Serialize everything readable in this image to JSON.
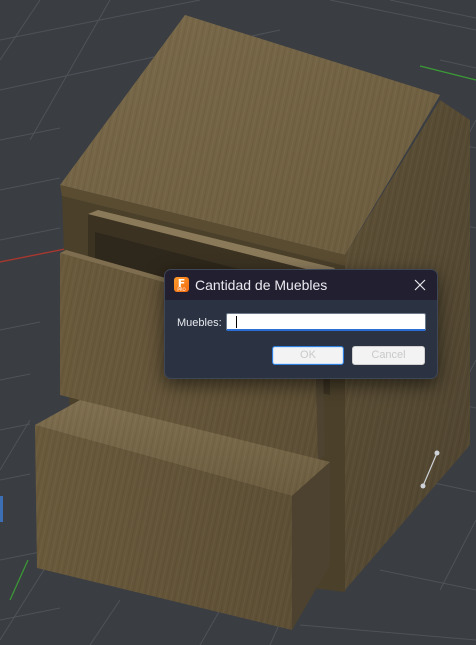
{
  "viewport": {
    "background": "#3a3d42",
    "grid_color": "#55585e",
    "axis_red": "#b8392f",
    "axis_green": "#3fae3a",
    "wood_light": "#756546",
    "wood_mid": "#5f5236",
    "wood_dark": "#4a3f28"
  },
  "dialog": {
    "title": "Cantidad de Muebles",
    "app_icon": {
      "name": "fusion-app-icon",
      "glyph": "F",
      "sub": "PRO",
      "color": "#f57c1f"
    },
    "close_icon": "close-icon",
    "field_label": "Muebles:",
    "input_value": "",
    "ok_label": "OK",
    "cancel_label": "Cancel",
    "accent": "#2f7fe0"
  }
}
